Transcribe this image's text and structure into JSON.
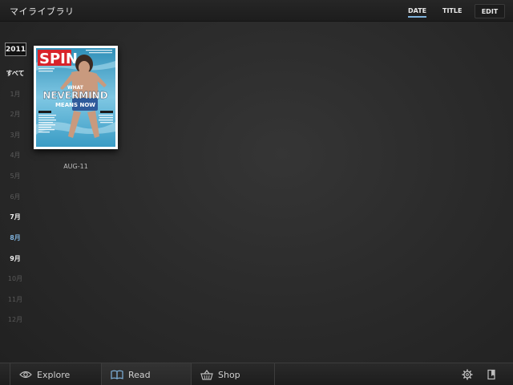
{
  "header": {
    "title": "マイライブラリ",
    "sort_tabs": [
      {
        "label": "DATE",
        "active": true
      },
      {
        "label": "TITLE",
        "active": false
      }
    ],
    "edit_label": "EDIT"
  },
  "sidebar": {
    "year": "2011",
    "items": [
      {
        "label": "すべて",
        "state": "bright"
      },
      {
        "label": "1月",
        "state": "dim"
      },
      {
        "label": "2月",
        "state": "dim"
      },
      {
        "label": "3月",
        "state": "dim"
      },
      {
        "label": "4月",
        "state": "dim"
      },
      {
        "label": "5月",
        "state": "dim"
      },
      {
        "label": "6月",
        "state": "dim"
      },
      {
        "label": "7月",
        "state": "bright"
      },
      {
        "label": "8月",
        "state": "selected"
      },
      {
        "label": "9月",
        "state": "bright"
      },
      {
        "label": "10月",
        "state": "dim"
      },
      {
        "label": "11月",
        "state": "dim"
      },
      {
        "label": "12月",
        "state": "dim"
      }
    ]
  },
  "library": {
    "items": [
      {
        "date_label": "AUG-11",
        "cover": {
          "masthead": "SPIN",
          "headline_top": "WHAT",
          "headline_main": "NEVERMIND",
          "headline_bottom": "MEANS NOW"
        }
      }
    ]
  },
  "bottombar": {
    "tabs": [
      {
        "label": "Explore",
        "icon": "eye-icon"
      },
      {
        "label": "Read",
        "icon": "open-book-icon"
      },
      {
        "label": "Shop",
        "icon": "basket-icon"
      }
    ],
    "tools": [
      "gear-icon",
      "bookmark-icon"
    ]
  },
  "colors": {
    "accent": "#7fb2dc",
    "background": "#2a2a2a",
    "masthead_red": "#d8232a"
  }
}
